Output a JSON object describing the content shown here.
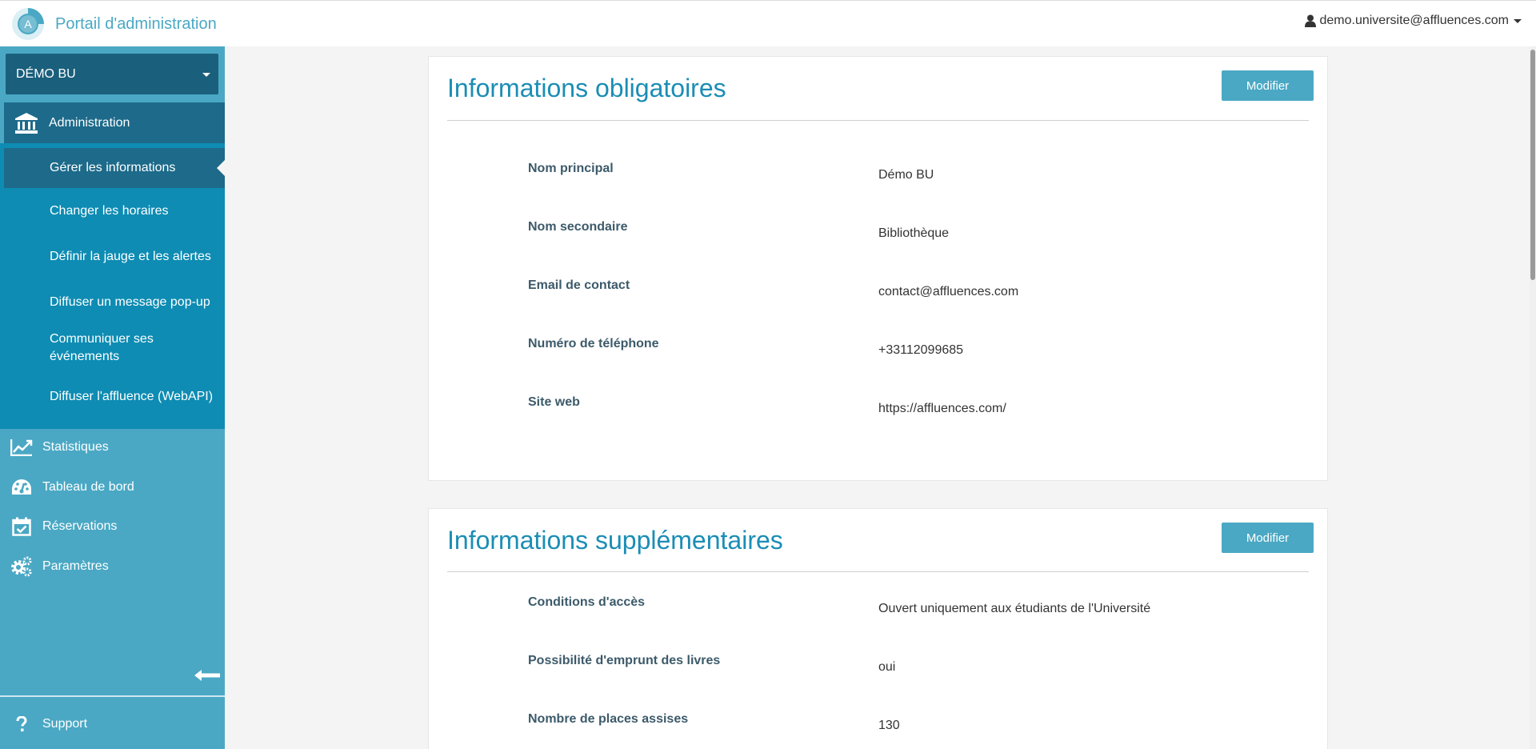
{
  "app": {
    "title": "Portail d'administration"
  },
  "user": {
    "email": "demo.universite@affluences.com"
  },
  "sidebar": {
    "org_name": "DÉMO BU",
    "admin_label": "Administration",
    "sub_items": [
      "Gérer les informations",
      "Changer les horaires",
      "Définir la jauge et les alertes",
      "Diffuser un message pop-up",
      "Communiquer ses événements",
      "Diffuser l'affluence (WebAPI)"
    ],
    "nav_items": [
      "Statistiques",
      "Tableau de bord",
      "Réservations",
      "Paramètres"
    ],
    "support_label": "Support"
  },
  "panels": {
    "mandatory": {
      "title": "Informations obligatoires",
      "button": "Modifier",
      "fields": [
        {
          "label": "Nom principal",
          "value": "Démo BU"
        },
        {
          "label": "Nom secondaire",
          "value": "Bibliothèque"
        },
        {
          "label": "Email de contact",
          "value": "contact@affluences.com"
        },
        {
          "label": "Numéro de téléphone",
          "value": "+33112099685"
        },
        {
          "label": "Site web",
          "value": "https://affluences.com/"
        }
      ]
    },
    "extra": {
      "title": "Informations supplémentaires",
      "button": "Modifier",
      "fields": [
        {
          "label": "Conditions d'accès",
          "value": "Ouvert uniquement aux étudiants de l'Université"
        },
        {
          "label": "Possibilité d'emprunt des livres",
          "value": "oui"
        },
        {
          "label": "Nombre de places assises",
          "value": "130"
        }
      ]
    }
  },
  "colors": {
    "accent": "#4aa8c4",
    "sidebar_dark": "#1d6a8a",
    "sidebar_mid": "#0e8cb3",
    "title": "#1b8db5"
  },
  "icons": [
    "logo-icon",
    "user-icon",
    "bank-icon",
    "chart-line-icon",
    "gauge-icon",
    "calendar-check-icon",
    "gears-icon",
    "question-icon",
    "arrow-left-icon"
  ]
}
